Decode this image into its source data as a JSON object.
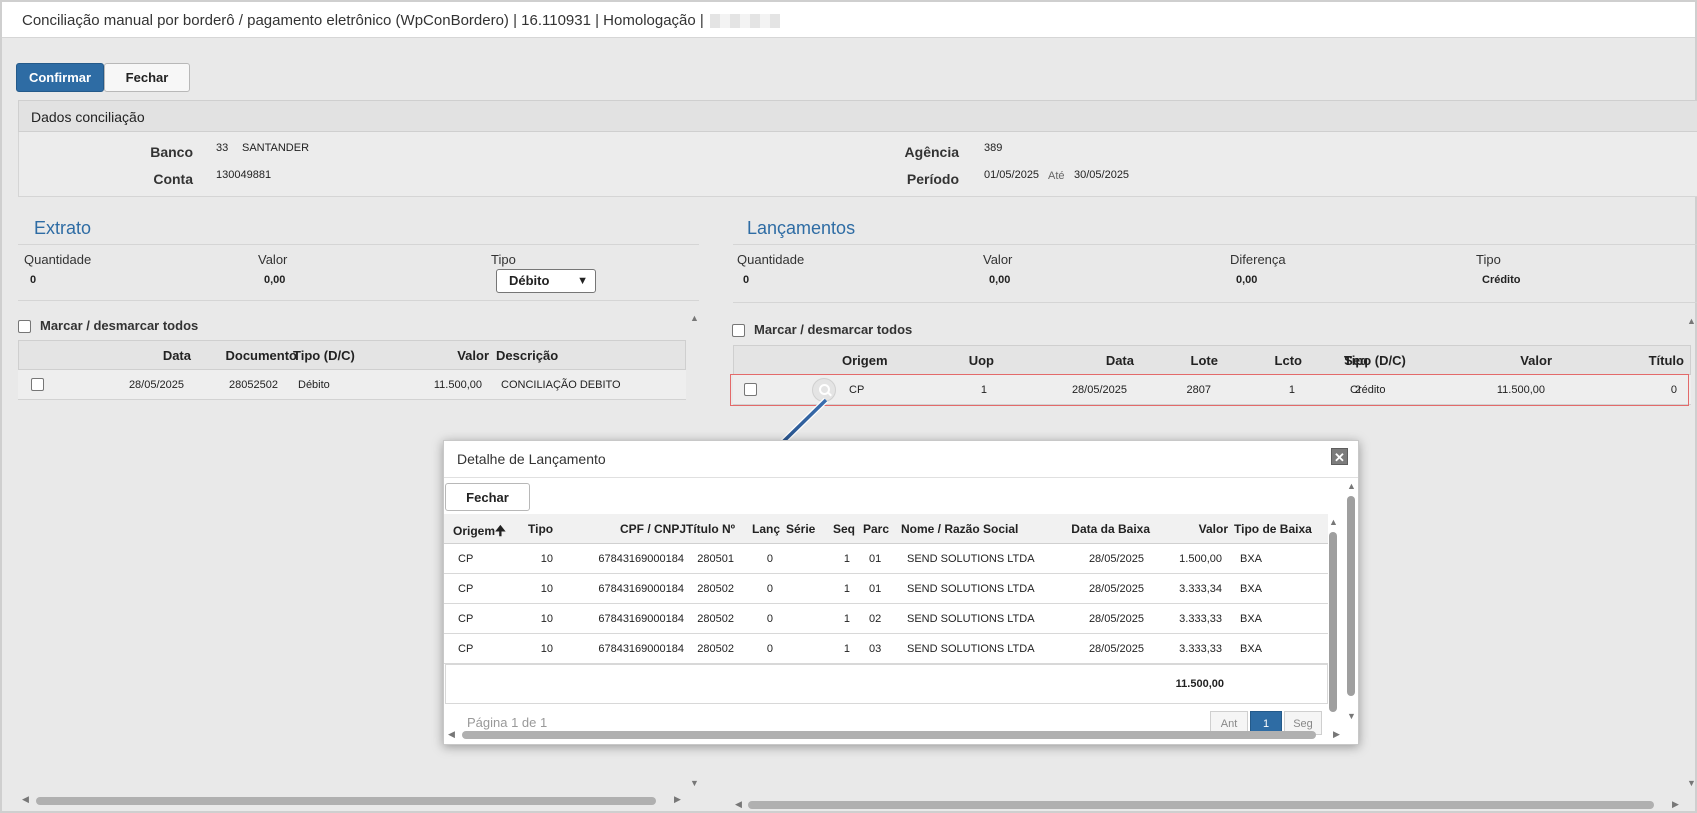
{
  "window": {
    "title": "Conciliação manual por borderô / pagamento eletrônico (WpConBordero) | 16.110931 | Homologação |"
  },
  "toolbar": {
    "confirm_label": "Confirmar",
    "close_label": "Fechar"
  },
  "dados": {
    "title": "Dados conciliação",
    "banco_label": "Banco",
    "banco_code": "33",
    "banco_name": "SANTANDER",
    "conta_label": "Conta",
    "conta_value": "130049881",
    "agencia_label": "Agência",
    "agencia_value": "389",
    "periodo_label": "Período",
    "periodo_from": "01/05/2025",
    "periodo_ate": "Até",
    "periodo_to": "30/05/2025"
  },
  "extrato": {
    "title": "Extrato",
    "quantidade_label": "Quantidade",
    "quantidade_value": "0",
    "valor_label": "Valor",
    "valor_value": "0,00",
    "tipo_label": "Tipo",
    "tipo_value": "Débito",
    "mark_all": "Marcar / desmarcar todos",
    "columns": [
      "Data",
      "Documento",
      "Tipo (D/C)",
      "Valor",
      "Descrição"
    ],
    "rows": [
      {
        "data": "28/05/2025",
        "documento": "28052502",
        "tipo": "Débito",
        "valor": "11.500,00",
        "descricao": "CONCILIAÇÃO DEBITO"
      }
    ]
  },
  "lancamentos": {
    "title": "Lançamentos",
    "quantidade_label": "Quantidade",
    "quantidade_value": "0",
    "valor_label": "Valor",
    "valor_value": "0,00",
    "diferenca_label": "Diferença",
    "diferenca_value": "0,00",
    "tipo_label": "Tipo",
    "tipo_value": "Crédito",
    "mark_all": "Marcar / desmarcar todos",
    "columns": [
      "Origem",
      "Uop",
      "Data",
      "Lote",
      "Lcto",
      "Seq",
      "Tipo (D/C)",
      "Valor",
      "Título"
    ],
    "rows": [
      {
        "origem": "CP",
        "uop": "1",
        "data": "28/05/2025",
        "lote": "2807",
        "lcto": "1",
        "seq": "2",
        "tipo": "Crédito",
        "valor": "11.500,00",
        "titulo": "0"
      }
    ]
  },
  "modal": {
    "title": "Detalhe de Lançamento",
    "close_label": "Fechar",
    "columns": [
      "Origem",
      "Tipo",
      "CPF / CNPJ",
      "Título Nº",
      "Lanç",
      "Série",
      "Seq",
      "Parc",
      "Nome / Razão Social",
      "Data da Baixa",
      "Valor",
      "Tipo de Baixa"
    ],
    "rows": [
      {
        "origem": "CP",
        "tipo": "10",
        "cnpj": "67843169000184",
        "titulo": "280501",
        "lanc": "0",
        "serie": "",
        "seq": "1",
        "parc": "01",
        "nome": "SEND SOLUTIONS LTDA",
        "data": "28/05/2025",
        "valor": "1.500,00",
        "tipo_baixa": "BXA"
      },
      {
        "origem": "CP",
        "tipo": "10",
        "cnpj": "67843169000184",
        "titulo": "280502",
        "lanc": "0",
        "serie": "",
        "seq": "1",
        "parc": "01",
        "nome": "SEND SOLUTIONS LTDA",
        "data": "28/05/2025",
        "valor": "3.333,34",
        "tipo_baixa": "BXA"
      },
      {
        "origem": "CP",
        "tipo": "10",
        "cnpj": "67843169000184",
        "titulo": "280502",
        "lanc": "0",
        "serie": "",
        "seq": "1",
        "parc": "02",
        "nome": "SEND SOLUTIONS LTDA",
        "data": "28/05/2025",
        "valor": "3.333,33",
        "tipo_baixa": "BXA"
      },
      {
        "origem": "CP",
        "tipo": "10",
        "cnpj": "67843169000184",
        "titulo": "280502",
        "lanc": "0",
        "serie": "",
        "seq": "1",
        "parc": "03",
        "nome": "SEND SOLUTIONS LTDA",
        "data": "28/05/2025",
        "valor": "3.333,33",
        "tipo_baixa": "BXA"
      }
    ],
    "total": "11.500,00",
    "pagination": {
      "text": "Página 1 de 1",
      "prev": "Ant",
      "current": "1",
      "next": "Seg"
    }
  }
}
